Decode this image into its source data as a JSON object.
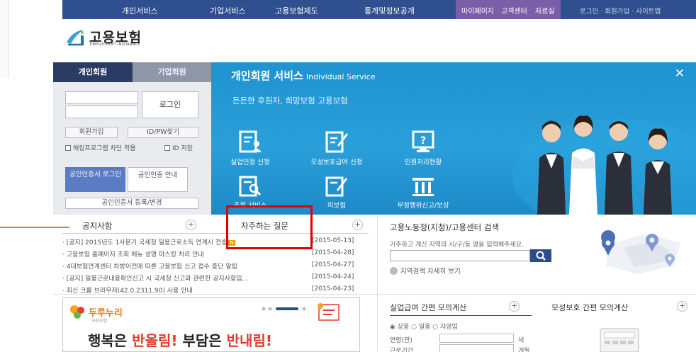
{
  "topnav": {
    "items": [
      "개인서비스",
      "기업서비스",
      "고용보험제도",
      "통계및정보공개"
    ],
    "mypage_items": [
      "마이페이지",
      "고객센터",
      "자료실"
    ],
    "util_text": "로그인 · 회원가입 · 사이트맵"
  },
  "logo": {
    "name": "고용보험",
    "sub": "EMPLOYMENT INSURANCE"
  },
  "login": {
    "tabs": [
      "개인회원",
      "기업회원"
    ],
    "login_button": "로그인",
    "join_button": "회원가입",
    "find_button": "ID/PW찾기",
    "check1": "해킹프로그램 차단 적용",
    "check2": "ID 저장",
    "cert_login": "공인인증서 로그인",
    "cert_guide": "공인인증 안내",
    "cert_register": "공인인증서 등록/변경"
  },
  "service": {
    "title": "개인회원 서비스",
    "title_en": "Individual Service",
    "close": "✕",
    "tagline": "든든한 후원자, 희망보험 고용보험",
    "icons": [
      {
        "icon": "person-doc-icon",
        "label": "실업인정 신청"
      },
      {
        "icon": "pen-doc-icon",
        "label": "모성보호급여 신청"
      },
      {
        "icon": "question-monitor-icon",
        "label": "민원처리현황"
      },
      {
        "icon": "search-doc-icon",
        "label": "조회 서비스"
      },
      {
        "icon": "pen-doc-icon",
        "label": "피보험"
      },
      {
        "icon": "pillars-icon",
        "label": "부정행위신고/보상"
      }
    ]
  },
  "notice": {
    "heading": "공지사항",
    "plus": "+"
  },
  "faq": {
    "heading": "자주하는 질문",
    "plus": "+"
  },
  "list": [
    {
      "text": "[공지] 2015년도 1사분기 국세청 일용근로소득 연계시 전송",
      "new": "N",
      "date": "[2015-05-13]"
    },
    {
      "text": "고용보험 홈페이지 조회 메뉴 성명 마스킹 처리 안내",
      "new": "",
      "date": "[2015-04-28]"
    },
    {
      "text": "4대보험연계센터 차방이전에 따른 고용보험 신고 접수 중단 알림",
      "new": "",
      "date": "[2015-04-27]"
    },
    {
      "text": "[공지] 일용근로내용확인신고 시 국세청 신고와 관련한 공지사항입...",
      "new": "",
      "date": "[2015-04-24]"
    },
    {
      "text": "최신 크롬 브라우저(42.0.2311.90) 사용 안내",
      "new": "",
      "date": "[2015-04-23]"
    }
  ],
  "search": {
    "heading": "고용노동청(지청)/고용센터 검색",
    "desc": "거주하고 계신 지역의 시/구/동 명을 입력해주세요.",
    "link": "지역검색 자세히 보기"
  },
  "banner": {
    "brand": "두루누리",
    "brand_sub": "사회보험",
    "main_part1": "행복은 ",
    "main_bold1": "반올림!",
    "main_part2": " 부담은 ",
    "main_bold2": "반내림!"
  },
  "calc": {
    "tab1": "실업급여 간편 모의계산",
    "tab2": "모성보호 간편 모의계산",
    "radios": "◉ 상용  ○ 일용  ○ 자영업",
    "age_label": "연령(만)",
    "age_unit": "세",
    "period_label": "근로기간",
    "period_unit": "개월"
  },
  "colors": {
    "nav": "#2f4f8f",
    "mypage": "#7a5ea8",
    "service": "#1e93cf",
    "highlight": "#e20000"
  }
}
